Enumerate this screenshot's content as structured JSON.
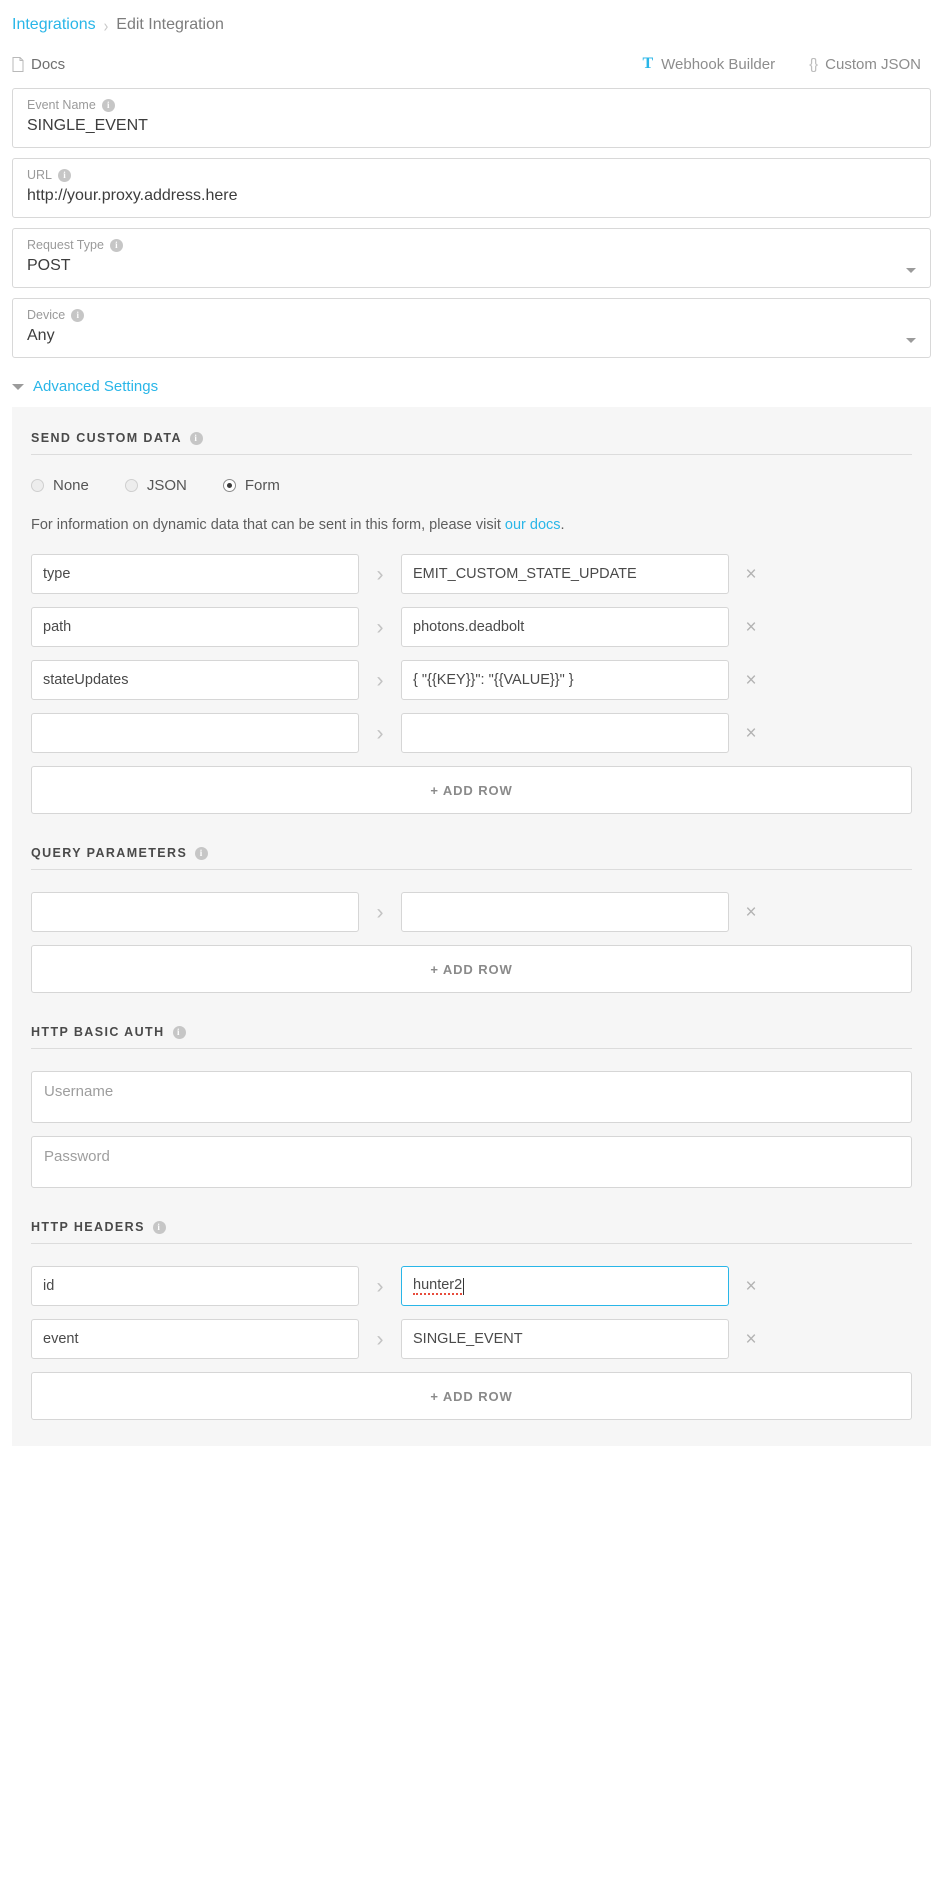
{
  "breadcrumb": {
    "root": "Integrations",
    "separator": "›",
    "current": "Edit Integration"
  },
  "toolbar": {
    "docs_label": "Docs",
    "docs_icon": "document-icon",
    "tabs": [
      {
        "label": "Webhook Builder",
        "icon": "hammer-icon",
        "icon_glyph": "T",
        "active": true
      },
      {
        "label": "Custom JSON",
        "icon": "braces-icon",
        "icon_glyph": "{}",
        "active": false
      }
    ]
  },
  "fields": [
    {
      "label": "Event Name",
      "value": "SINGLE_EVENT",
      "type": "text",
      "info": "i"
    },
    {
      "label": "URL",
      "value": "http://your.proxy.address.here",
      "type": "text",
      "info": "i"
    },
    {
      "label": "Request Type",
      "value": "POST",
      "type": "select",
      "info": "i"
    },
    {
      "label": "Device",
      "value": "Any",
      "type": "select",
      "info": "i"
    }
  ],
  "advanced": {
    "label": "Advanced Settings",
    "expanded": true,
    "toggle_icon": "chevron-down-icon"
  },
  "send_custom_data": {
    "title": "SEND CUSTOM DATA",
    "info": "i",
    "options": [
      {
        "label": "None",
        "selected": false
      },
      {
        "label": "JSON",
        "selected": false
      },
      {
        "label": "Form",
        "selected": true
      }
    ],
    "help_prefix": "For information on dynamic data that can be sent in this form, please visit ",
    "help_link": "our docs",
    "help_suffix": ".",
    "rows": [
      {
        "key": "type",
        "value": "EMIT_CUSTOM_STATE_UPDATE"
      },
      {
        "key": "path",
        "value": "photons.deadbolt"
      },
      {
        "key": "stateUpdates",
        "value": "{ \"{{KEY}}\": \"{{VALUE}}\" }"
      },
      {
        "key": "",
        "value": ""
      }
    ],
    "add_row_label": "+ ADD ROW"
  },
  "query_parameters": {
    "title": "QUERY PARAMETERS",
    "info": "i",
    "rows": [
      {
        "key": "",
        "value": ""
      }
    ],
    "add_row_label": "+ ADD ROW"
  },
  "http_basic_auth": {
    "title": "HTTP BASIC AUTH",
    "info": "i",
    "username_placeholder": "Username",
    "username_value": "",
    "password_placeholder": "Password",
    "password_value": ""
  },
  "http_headers": {
    "title": "HTTP HEADERS",
    "info": "i",
    "rows": [
      {
        "key": "id",
        "value": "hunter2",
        "focused": true,
        "spellcheck_error": true
      },
      {
        "key": "event",
        "value": "SINGLE_EVENT",
        "focused": false,
        "spellcheck_error": false
      }
    ],
    "add_row_label": "+ ADD ROW"
  },
  "icons": {
    "chevron_right": "›",
    "close": "×"
  },
  "colors": {
    "accent": "#29b6e8",
    "panel_bg": "#f6f6f6",
    "border": "#d6d6d6",
    "text": "#5a5a5a",
    "muted": "#9a9a9a",
    "spellcheck": "#e74c3c"
  }
}
